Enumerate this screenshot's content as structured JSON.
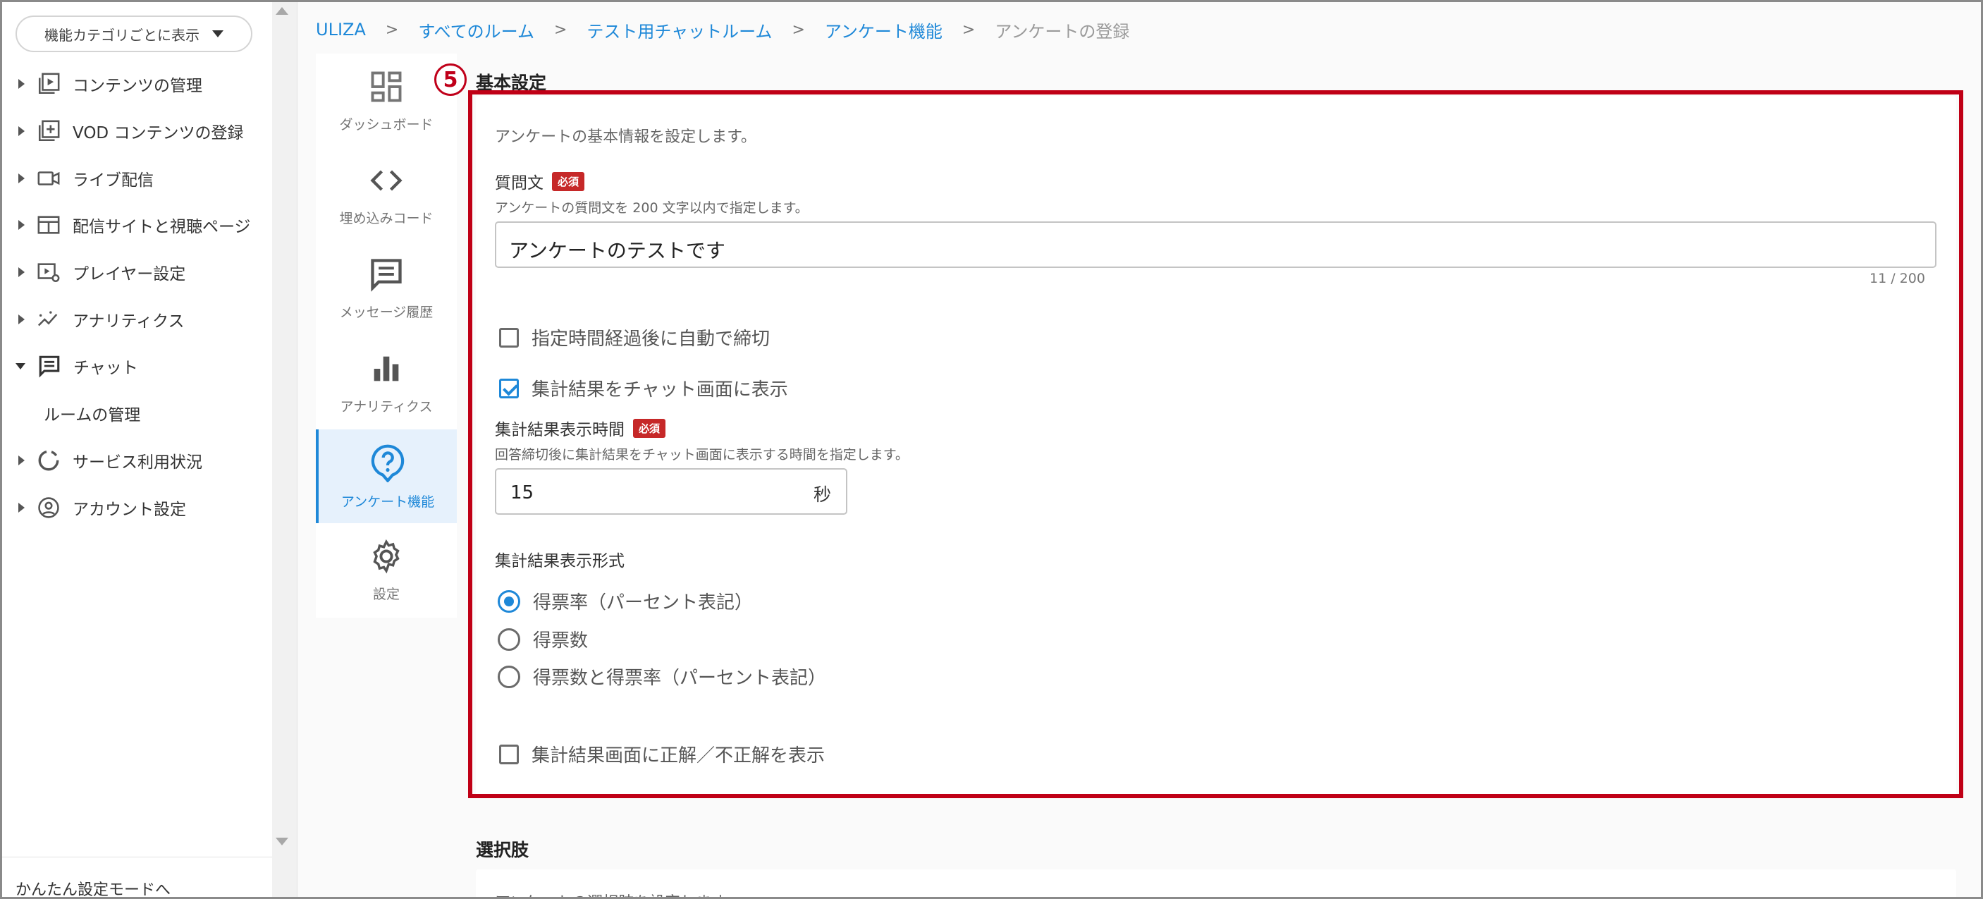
{
  "sidebar": {
    "category_button": "機能カテゴリごとに表示",
    "items": [
      {
        "label": "コンテンツの管理",
        "icon": "content-icon"
      },
      {
        "label": "VOD コンテンツの登録",
        "icon": "add-box-icon"
      },
      {
        "label": "ライブ配信",
        "icon": "video-camera-icon"
      },
      {
        "label": "配信サイトと視聴ページ",
        "icon": "web-icon"
      },
      {
        "label": "プレイヤー設定",
        "icon": "player-settings-icon"
      },
      {
        "label": "アナリティクス",
        "icon": "analytics-icon"
      },
      {
        "label": "チャット",
        "icon": "chat-icon"
      },
      {
        "label": "ルームの管理"
      },
      {
        "label": "サービス利用状況",
        "icon": "usage-icon"
      },
      {
        "label": "アカウント設定",
        "icon": "account-icon"
      }
    ],
    "footer_link": "かんたん設定モードへ"
  },
  "breadcrumb": [
    "ULIZA",
    "すべてのルーム",
    "テスト用チャットルーム",
    "アンケート機能",
    "アンケートの登録"
  ],
  "rail": [
    {
      "label": "ダッシュボード",
      "icon": "dashboard-icon"
    },
    {
      "label": "埋め込みコード",
      "icon": "code-icon"
    },
    {
      "label": "メッセージ履歴",
      "icon": "message-icon"
    },
    {
      "label": "アナリティクス",
      "icon": "bar-chart-icon"
    },
    {
      "label": "アンケート機能",
      "icon": "question-icon"
    },
    {
      "label": "設定",
      "icon": "gear-icon"
    }
  ],
  "form": {
    "step_number": "5",
    "section_title": "基本設定",
    "section_desc": "アンケートの基本情報を設定します。",
    "question": {
      "label": "質問文",
      "required": "必須",
      "hint": "アンケートの質問文を 200 文字以内で指定します。",
      "value": "アンケートのテストです",
      "counter": "11 / 200"
    },
    "auto_close_label": "指定時間経過後に自動で締切",
    "show_result_label": "集計結果をチャット画面に表示",
    "display_time": {
      "label": "集計結果表示時間",
      "required": "必須",
      "hint": "回答締切後に集計結果をチャット画面に表示する時間を指定します。",
      "value": "15",
      "unit": "秒"
    },
    "format": {
      "label": "集計結果表示形式",
      "options": [
        "得票率（パーセント表記）",
        "得票数",
        "得票数と得票率（パーセント表記）"
      ],
      "selected": 0
    },
    "show_correct_label": "集計結果画面に正解／不正解を表示"
  },
  "choices": {
    "section_title": "選択肢",
    "section_desc": "アンケートの選択肢を設定します。"
  },
  "colors": {
    "accent": "#1e88d8",
    "highlight": "#c00016",
    "required": "#c62828"
  }
}
